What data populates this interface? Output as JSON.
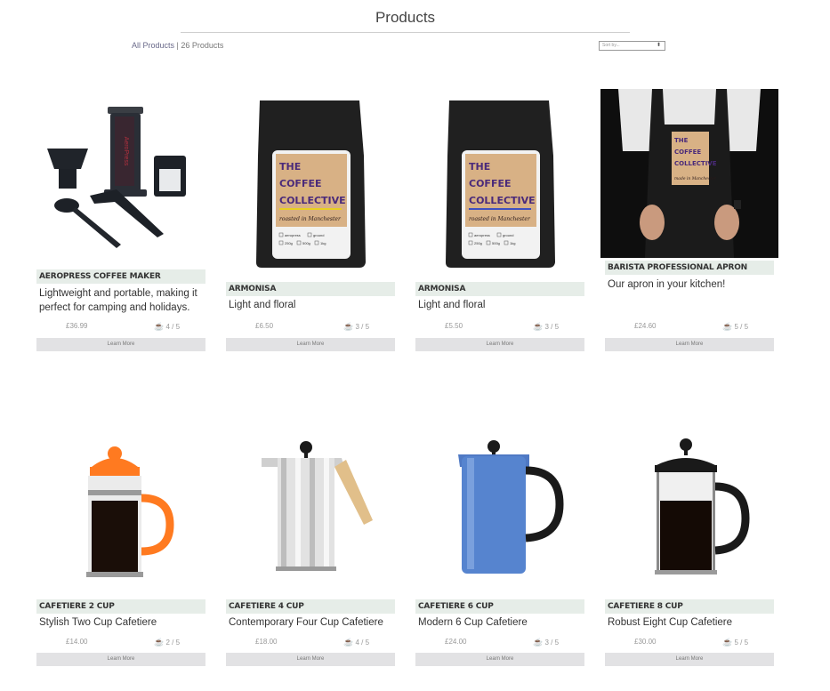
{
  "header": {
    "title": "Products"
  },
  "breadcrumb": {
    "all_products": "All Products",
    "separator": "|",
    "count": "26 Products"
  },
  "sort": {
    "placeholder": "Sort by..."
  },
  "products": [
    {
      "name": "Aeropress Coffee Maker",
      "desc": "Lightweight and portable, making it perfect for camping and holidays.",
      "price": "£36.99",
      "rating": "4 / 5",
      "button": "Learn More",
      "image": "aeropress"
    },
    {
      "name": "Armonisa",
      "desc": "Light and floral",
      "price": "£6.50",
      "rating": "3 / 5",
      "button": "Learn More",
      "image": "coffee-bag"
    },
    {
      "name": "Armonisa",
      "desc": "Light and floral",
      "price": "£5.50",
      "rating": "3 / 5",
      "button": "Learn More",
      "image": "coffee-bag"
    },
    {
      "name": "Barista Professional Apron",
      "desc": "Our apron in your kitchen!",
      "price": "£24.60",
      "rating": "5 / 5",
      "button": "Learn More",
      "image": "apron"
    },
    {
      "name": "Cafetiere 2 cup",
      "desc": "Stylish Two Cup Cafetiere",
      "price": "£14.00",
      "rating": "2 / 5",
      "button": "Learn More",
      "image": "cafetiere-orange"
    },
    {
      "name": "Cafetiere 4 cup",
      "desc": "Contemporary Four Cup Cafetiere",
      "price": "£18.00",
      "rating": "4 / 5",
      "button": "Learn More",
      "image": "cafetiere-steel"
    },
    {
      "name": "Cafetiere 6 cup",
      "desc": "Modern 6 Cup Cafetiere",
      "price": "£24.00",
      "rating": "3 / 5",
      "button": "Learn More",
      "image": "cafetiere-blue"
    },
    {
      "name": "Cafetiere 8 cup",
      "desc": "Robust Eight Cup Cafetiere",
      "price": "£30.00",
      "rating": "5 / 5",
      "button": "Learn More",
      "image": "cafetiere-black"
    }
  ],
  "bag_label": {
    "line1": "THE",
    "line2": "COFFEE",
    "line3": "COLLECTIVE",
    "tagline": "roasted in Manchester",
    "opt1": "aeropress",
    "opt2": "ground",
    "opt3": "250g",
    "opt4": "500g",
    "opt5": "1kg"
  },
  "apron_label": {
    "line1": "THE",
    "line2": "COFFEE",
    "line3": "COLLECTIVE",
    "tagline": "made in Manchester"
  },
  "aeropress_brand": "AeroPress",
  "icons": {
    "rating": "coffee-cup-icon",
    "sort": "chevron-updown-icon"
  },
  "colors": {
    "name_bar": "#e6ede8",
    "button": "#e2e2e4",
    "rating_icon": "#5a3fa0",
    "bag_label": "#d8b185"
  }
}
